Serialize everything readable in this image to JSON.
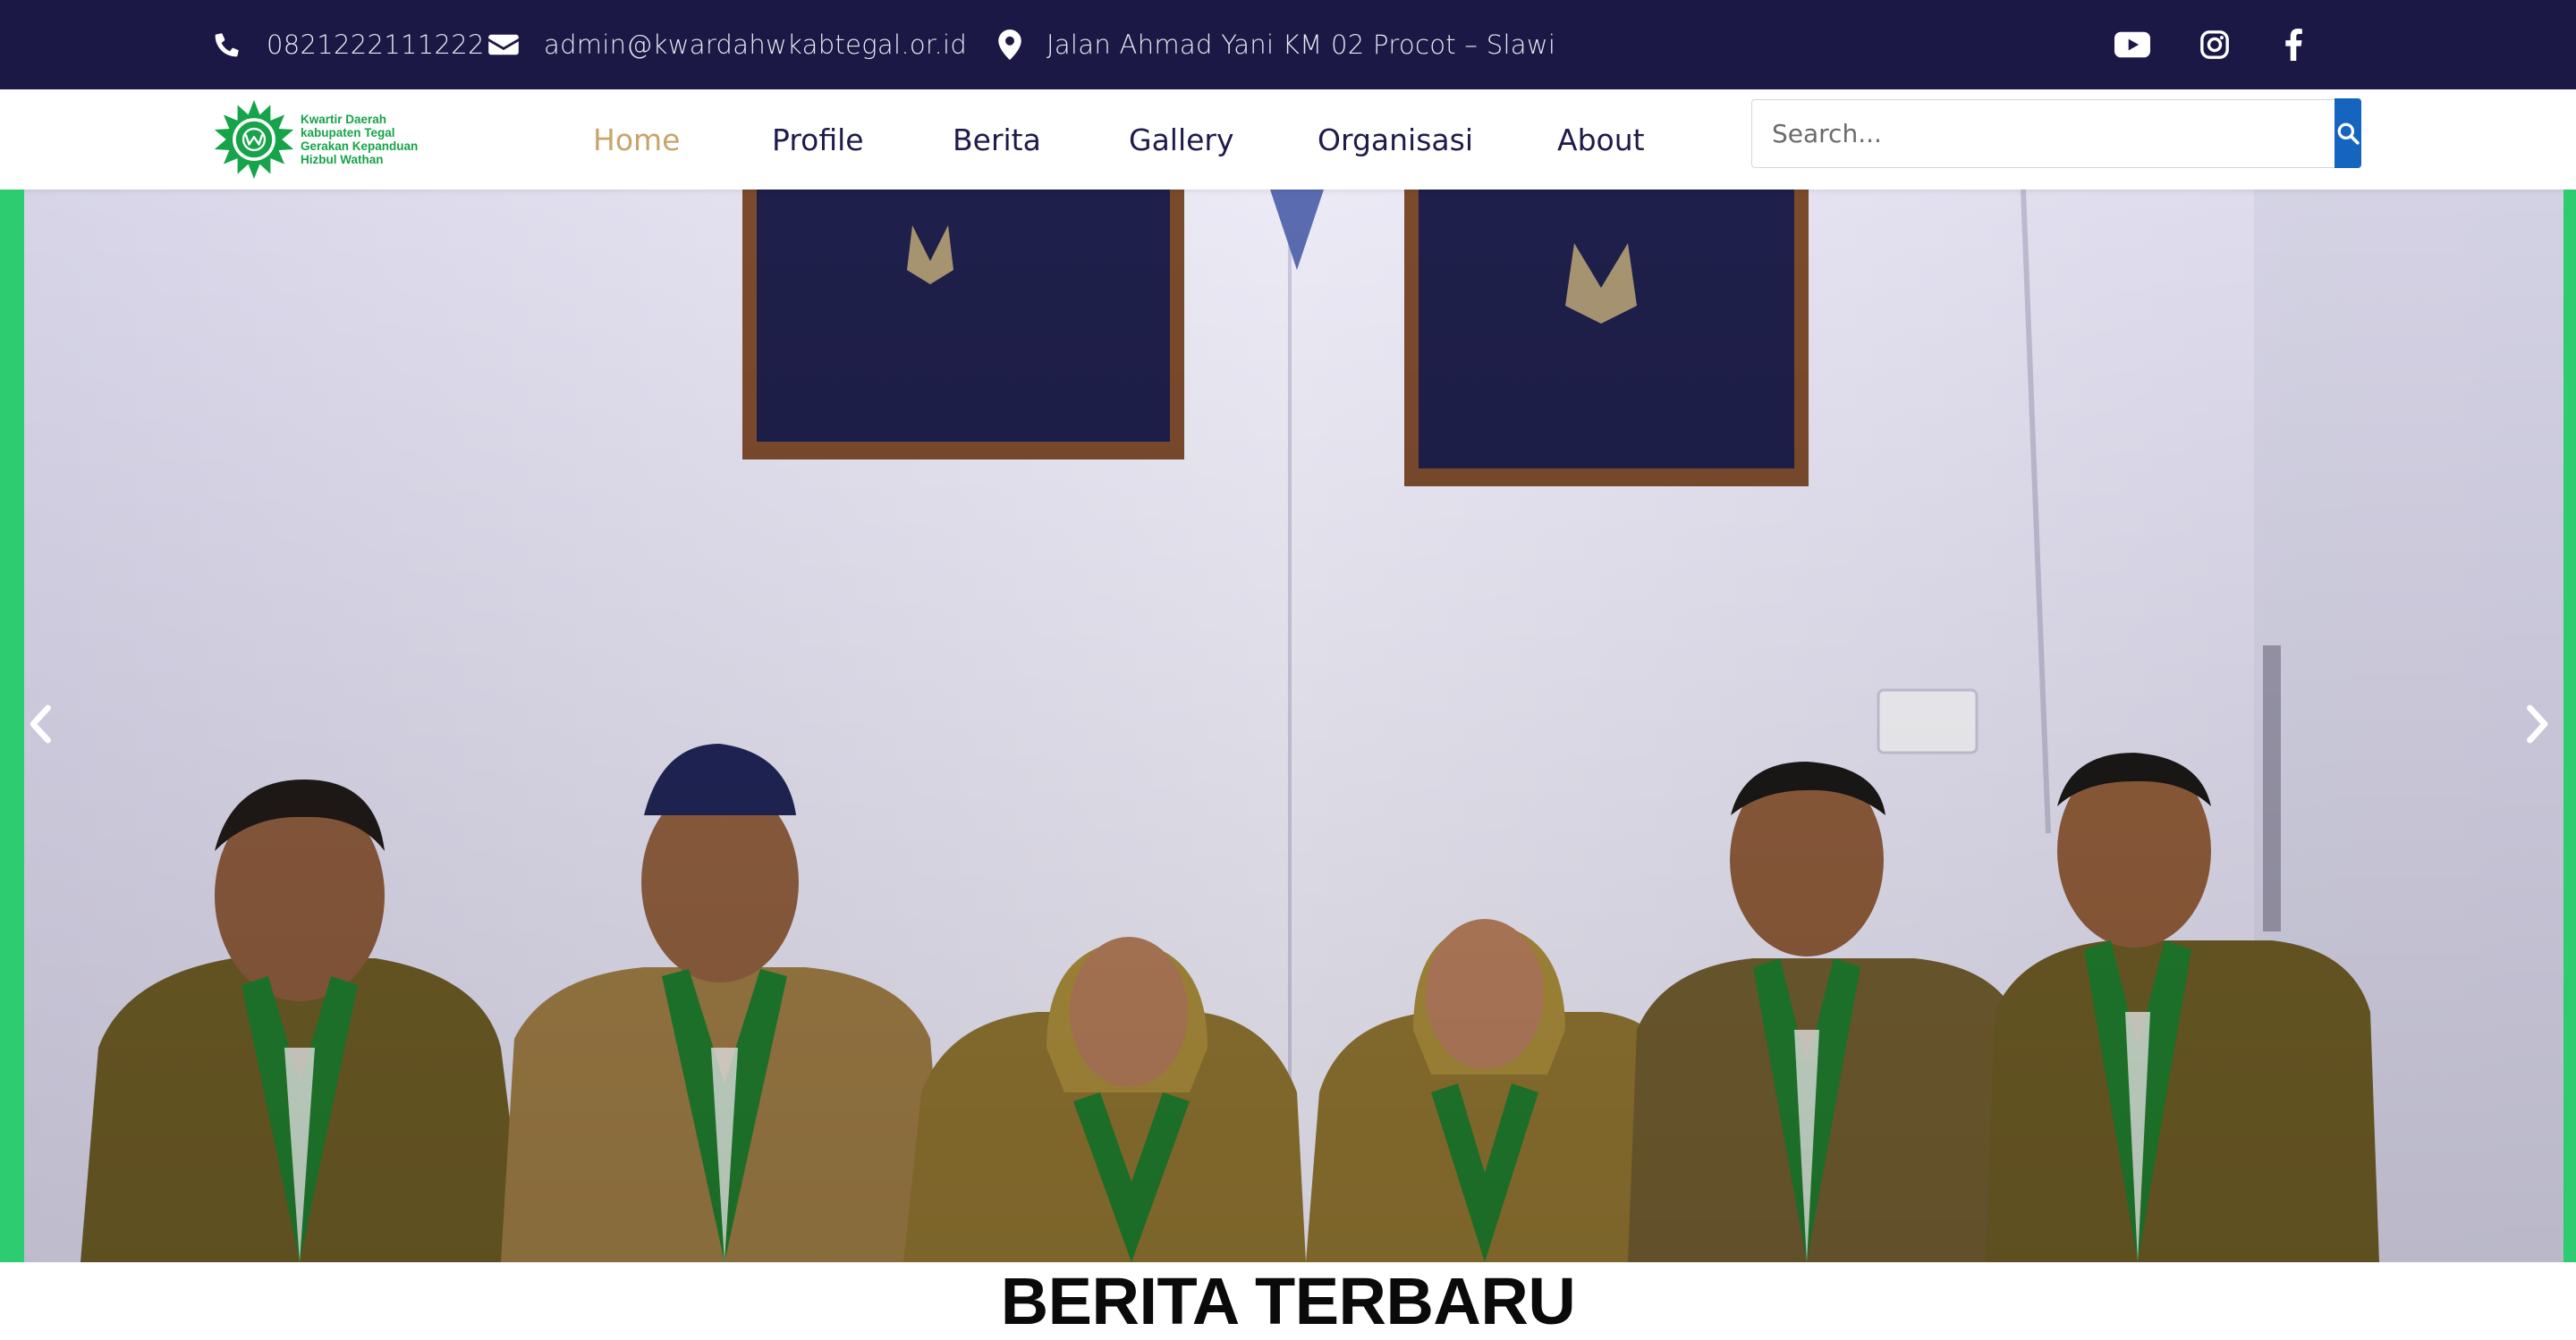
{
  "topbar": {
    "phone": "0821222111222",
    "email": "admin@kwardahwkabtegal.or.id",
    "address": "Jalan Ahmad Yani KM 02 Procot – Slawi",
    "icons": [
      "phone-icon",
      "envelope-icon",
      "map-pin-icon",
      "youtube-icon",
      "instagram-icon",
      "facebook-icon"
    ]
  },
  "logo": {
    "line1": "Kwartir Daerah",
    "line2": "kabupaten Tegal",
    "line3": "Gerakan Kepanduan",
    "line4": "Hizbul Wathan"
  },
  "nav": {
    "items": [
      {
        "label": "Home",
        "active": true
      },
      {
        "label": "Profile",
        "active": false
      },
      {
        "label": "Berita",
        "active": false
      },
      {
        "label": "Gallery",
        "active": false
      },
      {
        "label": "Organisasi",
        "active": false
      },
      {
        "label": "About",
        "active": false
      }
    ]
  },
  "search": {
    "placeholder": "Search..."
  },
  "slider": {
    "prev_icon": "chevron-left-icon",
    "next_icon": "chevron-right-icon"
  },
  "section": {
    "title": "BERITA TERBARU"
  },
  "colors": {
    "topbar_bg": "#1b1845",
    "nav_active": "#c8a46a",
    "nav_text": "#1e1b4b",
    "accent_green": "#2ecc71",
    "search_button": "#1565c0"
  }
}
